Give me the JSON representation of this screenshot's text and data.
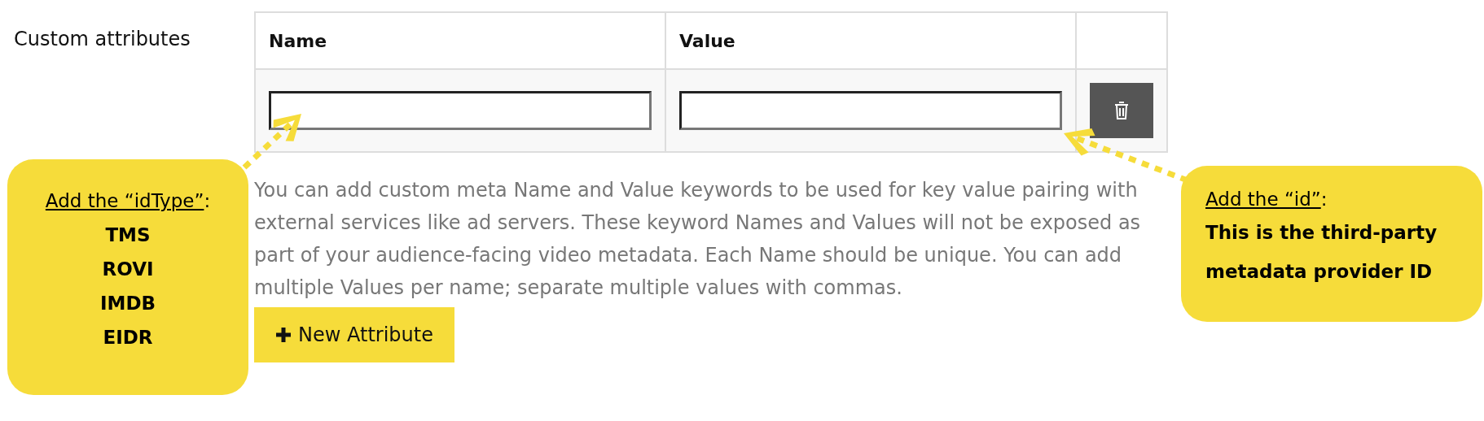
{
  "form": {
    "label": "Custom attributes",
    "table": {
      "columns": [
        "Name",
        "Value"
      ],
      "rows": [
        {
          "kind": "input_pair"
        }
      ]
    },
    "description": "You can add custom meta Name and Value keywords to be used for key value pairing with external services like ad servers. These keyword Names and Values will not be exposed as part of your audience-facing video metadata. Each Name should be unique. You can add multiple Values per name; separate multiple values with commas.",
    "add_button": {
      "label": "New Attribute"
    }
  },
  "callouts": [
    {
      "kind": "list",
      "heading": "Add the “idType”",
      "heading_suffix": ":",
      "lines": [
        "TMS",
        "ROVI",
        "IMDB",
        "EIDR"
      ]
    },
    {
      "kind": "note",
      "heading": "Add the “id”",
      "heading_suffix": ":",
      "lines": [
        "This is the third-party metadata provider ID"
      ]
    }
  ]
}
